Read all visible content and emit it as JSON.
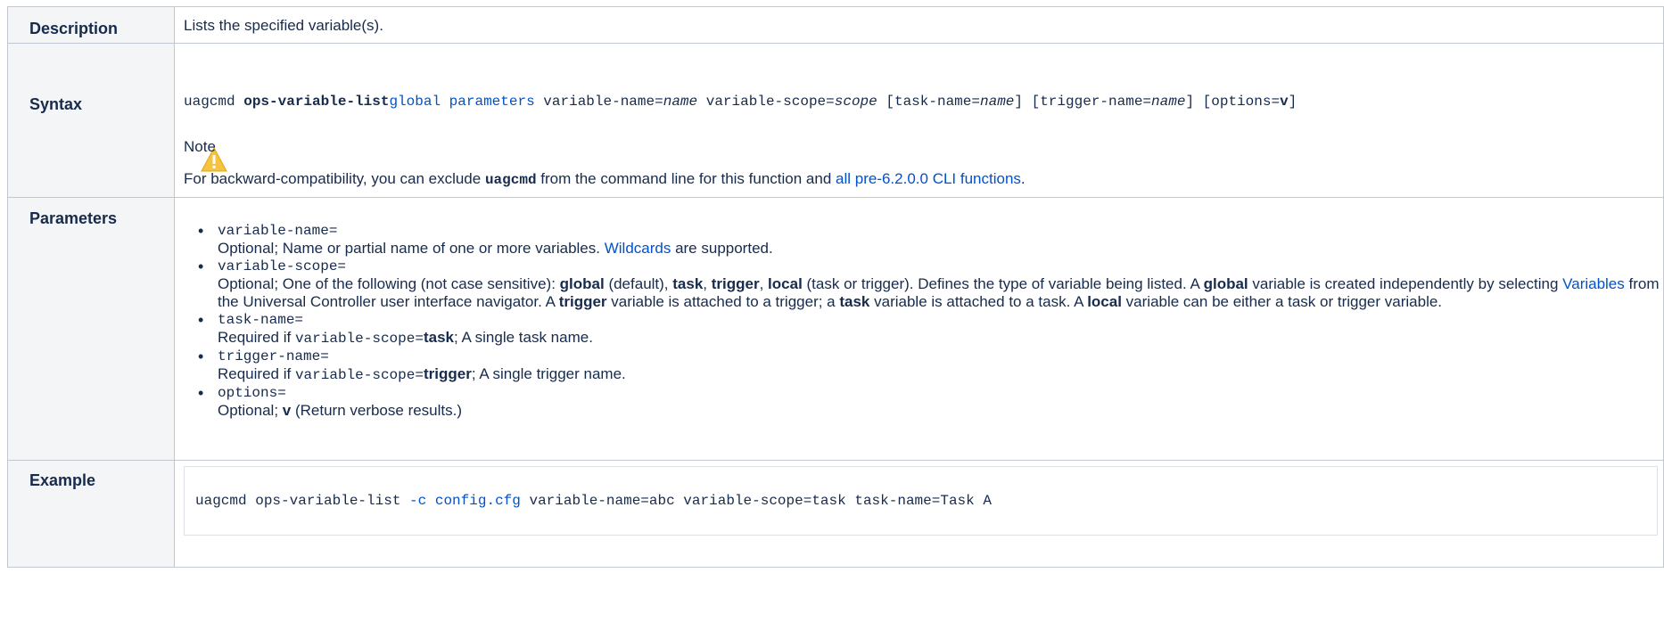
{
  "rows": {
    "description": {
      "label": "Description",
      "text": "Lists the specified variable(s)."
    },
    "syntax": {
      "label": "Syntax",
      "cmd": "uagcmd ",
      "func": "ops-variable-list",
      "global_params_link": "global parameters",
      "vn_pre": " variable-name=",
      "vn_val": "name",
      "vs_pre": " variable-scope=",
      "vs_val": "scope",
      "tn_pre": " [task-name=",
      "tn_val": "name",
      "tn_post": "]",
      "tr_pre": " [trigger-name=",
      "tr_val": "name",
      "tr_post": "]",
      "opt_pre": " [options=",
      "opt_val": "v",
      "opt_post": "]",
      "note_title": "Note",
      "note_pre": "For backward-compatibility, you can exclude ",
      "note_code": "uagcmd",
      "note_mid": " from the command line for this function and ",
      "note_link": "all pre-6.2.0.0 CLI functions",
      "note_post": "."
    },
    "parameters": {
      "label": "Parameters",
      "items": [
        {
          "name": "variable-name=",
          "desc_pre": "Optional; Name or partial name of one or more variables. ",
          "desc_link": "Wildcards",
          "desc_post": " are supported."
        },
        {
          "name": "variable-scope=",
          "d1": "Optional; One of the following (not case sensitive): ",
          "b1": "global",
          "d2": " (default), ",
          "b2": "task",
          "d3": ", ",
          "b3": "trigger",
          "d4": ", ",
          "b4": "local",
          "d5": " (task or trigger). Defines the type of variable being listed. A ",
          "b5": "global",
          "d6": " variable is created independently by selecting ",
          "link": "Variables",
          "d7": " from the Universal Controller user interface navigator. A ",
          "b6": "trigger",
          "d8": " variable is attached to a trigger; a ",
          "b7": "task",
          "d9": " variable is attached to a task. A ",
          "b8": "local",
          "d10": " variable can be either a task or trigger variable."
        },
        {
          "name": "task-name=",
          "d1": "Required if ",
          "code": "variable-scope=",
          "b1": "task",
          "d2": "; A single task name."
        },
        {
          "name": "trigger-name=",
          "d1": "Required if ",
          "code": "variable-scope=",
          "b1": "trigger",
          "d2": "; A single trigger name."
        },
        {
          "name": "options=",
          "d1": "Optional; ",
          "b1": "v",
          "d2": " (Return verbose results.)"
        }
      ]
    },
    "example": {
      "label": "Example",
      "pre": "uagcmd ops-variable-list ",
      "flag": "-c config.cfg",
      "post": " variable-name=abc variable-scope=task task-name=Task A"
    }
  },
  "icons": {
    "note_icon": "warning-icon"
  },
  "colors": {
    "link": "#0052cc",
    "header_bg": "#f4f5f7",
    "border": "#c1c7d0",
    "warning": "#f6c342"
  }
}
